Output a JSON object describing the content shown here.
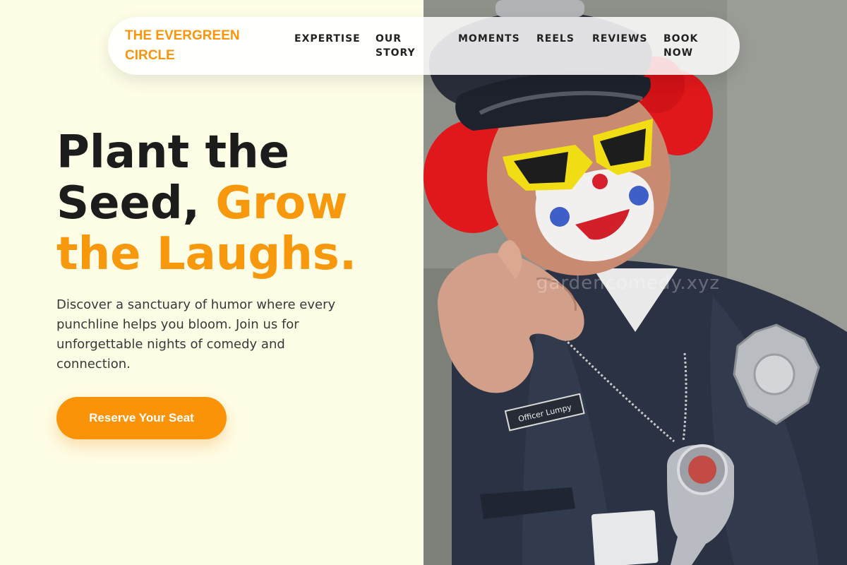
{
  "brand": {
    "name": "THE EVERGREEN CIRCLE"
  },
  "nav": {
    "items": [
      {
        "label": "EXPERTISE"
      },
      {
        "label": "OUR STORY"
      },
      {
        "label": "MOMENTS"
      },
      {
        "label": "REELS"
      },
      {
        "label": "REVIEWS"
      },
      {
        "label": "BOOK NOW"
      }
    ]
  },
  "hero": {
    "title_plain": "Plant the Seed,",
    "title_accent": "Grow the Laughs.",
    "description": "Discover a sanctuary of humor where every punchline helps you bloom. Join us for unforgettable nights of comedy and connection.",
    "cta_label": "Reserve Your Seat"
  },
  "photo": {
    "watermark": "gardencomedy.xyz",
    "badge_text": "Officer Lumpy"
  },
  "colors": {
    "accent": "#f8980c",
    "background": "#fefde6",
    "text_dark": "#1c1c1c"
  }
}
